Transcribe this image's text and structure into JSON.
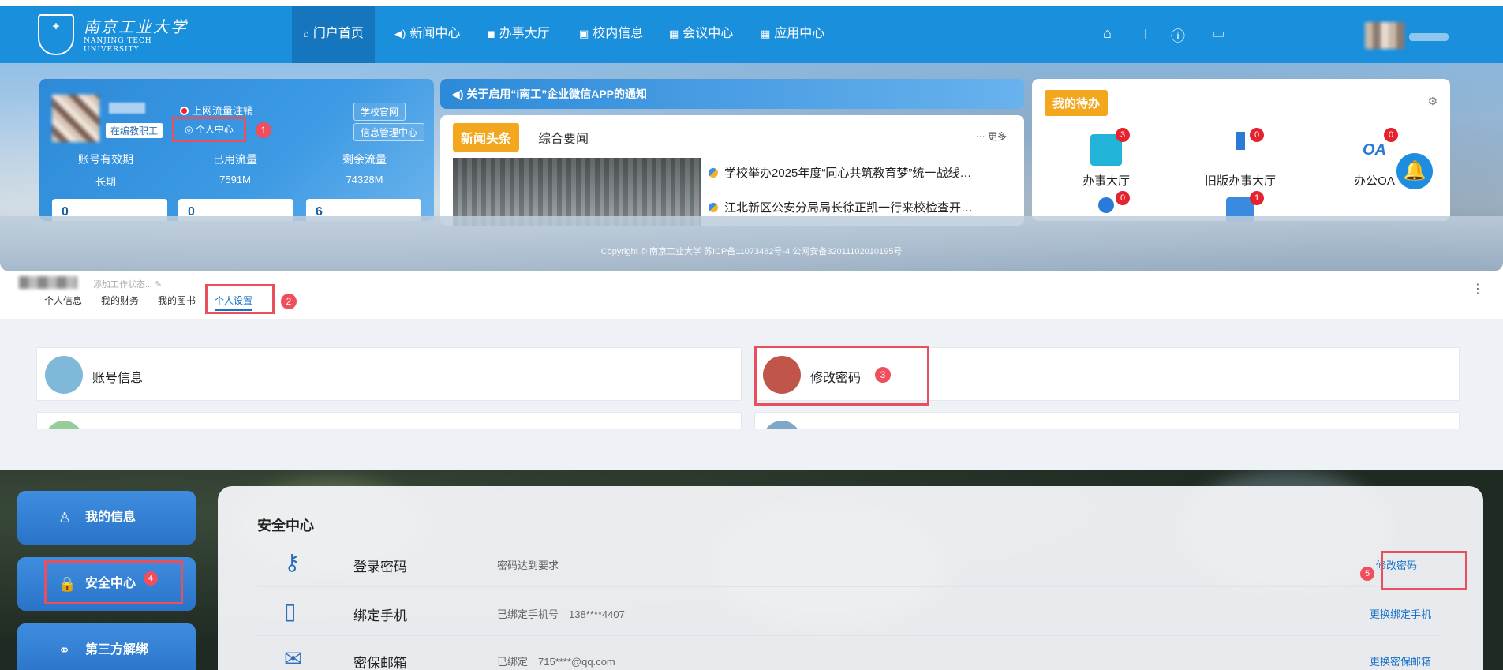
{
  "portal": {
    "logo_cn": "南京工业大学",
    "logo_en_line1": "NANJING TECH",
    "logo_en_line2": "UNIVERSITY",
    "nav": [
      {
        "icon": "⌂",
        "label": "门户首页"
      },
      {
        "icon": "◀)",
        "label": "新闻中心"
      },
      {
        "icon": "◼",
        "label": "办事大厅"
      },
      {
        "icon": "▣",
        "label": "校内信息"
      },
      {
        "icon": "▦",
        "label": "会议中心"
      },
      {
        "icon": "▦",
        "label": "应用中心"
      }
    ],
    "user_card": {
      "tag": "在编教职工",
      "logout": "上网流量注销",
      "personal_center": "个人中心",
      "badge1": "1",
      "link_official": "学校官网",
      "link_info": "信息管理中心",
      "stats": [
        {
          "label": "账号有效期",
          "value": "长期"
        },
        {
          "label": "已用流量",
          "value": "7591M"
        },
        {
          "label": "剩余流量",
          "value": "74328M"
        }
      ],
      "boxes": [
        "0",
        "0",
        "6"
      ]
    },
    "notice": "关于启用“i南工”企业微信APP的通知",
    "news": {
      "tab_hot": "新闻头条",
      "tab_general": "综合要闻",
      "more": "更多",
      "items": [
        "学校举办2025年度“同心共筑教育梦”统一战线…",
        "江北新区公安分局局长徐正凯一行来校检查开…"
      ]
    },
    "todo": {
      "title": "我的待办",
      "items": [
        {
          "label": "办事大厅",
          "count": "3"
        },
        {
          "label": "旧版办事大厅",
          "count": "0"
        },
        {
          "label": "办公OA",
          "count": "0",
          "icon_text": "OA"
        }
      ],
      "row2_counts": [
        "0",
        "1"
      ]
    },
    "copyright": "Copyright © 南京工业大学 苏ICP备11073482号-4 公网安备32011102010195号"
  },
  "settings": {
    "status_placeholder": "添加工作状态...",
    "tabs": [
      "个人信息",
      "我的财务",
      "我的图书",
      "个人设置"
    ],
    "badge2": "2",
    "cards": [
      {
        "label": "账号信息"
      },
      {
        "label": "修改密码",
        "badge": "3"
      }
    ]
  },
  "security": {
    "side": [
      {
        "icon": "♙",
        "label": "我的信息"
      },
      {
        "icon": "🔒",
        "label": "安全中心",
        "badge": "4"
      },
      {
        "icon": "⚭",
        "label": "第三方解绑"
      }
    ],
    "title": "安全中心",
    "rows": [
      {
        "name": "登录密码",
        "desc": "密码达到要求",
        "action": "修改密码",
        "badge": "5"
      },
      {
        "name": "绑定手机",
        "desc": "已绑定手机号　138****4407",
        "action": "更换绑定手机"
      },
      {
        "name": "密保邮箱",
        "desc": "已绑定　715****@qq.com",
        "action": "更换密保邮箱"
      }
    ]
  },
  "colors": {
    "nav_blue": "#1a8fdc",
    "highlight_red": "#e8505e",
    "accent_orange": "#f2a71f",
    "link_blue": "#1a73c8"
  }
}
